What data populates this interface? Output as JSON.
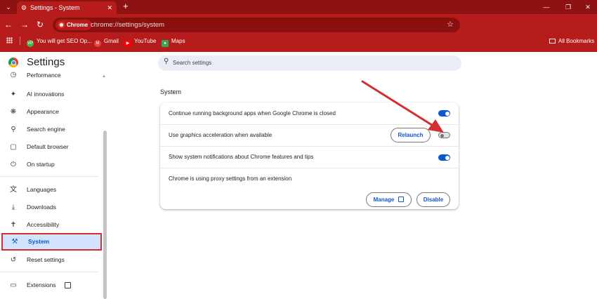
{
  "browser": {
    "tab_title": "Settings - System",
    "new_tab_glyph": "+",
    "chip_label": "Chrome",
    "url": "chrome://settings/system",
    "bookmarks": [
      {
        "label": "You will get SEO Op...",
        "icon": "vp-badge-icon",
        "color": "#4caf50"
      },
      {
        "label": "Gmail",
        "icon": "gmail-icon",
        "color": "#ea4335"
      },
      {
        "label": "YouTube",
        "icon": "youtube-icon",
        "color": "#ff0000"
      },
      {
        "label": "Maps",
        "icon": "maps-icon",
        "color": "#34a853"
      }
    ],
    "all_bookmarks": "All Bookmarks",
    "accent": "#b71c1c"
  },
  "header": {
    "title": "Settings",
    "search_placeholder": "Search settings"
  },
  "sidebar": {
    "items": [
      {
        "label": "Performance",
        "icon": "performance-icon"
      },
      {
        "label": "AI innovations",
        "icon": "sparkle-icon"
      },
      {
        "label": "Appearance",
        "icon": "palette-icon"
      },
      {
        "label": "Search engine",
        "icon": "search-icon"
      },
      {
        "label": "Default browser",
        "icon": "browser-window-icon"
      },
      {
        "label": "On startup",
        "icon": "power-icon"
      },
      {
        "label": "Languages",
        "icon": "translate-icon"
      },
      {
        "label": "Downloads",
        "icon": "download-icon"
      },
      {
        "label": "Accessibility",
        "icon": "accessibility-icon"
      },
      {
        "label": "System",
        "icon": "wrench-icon",
        "active": true
      },
      {
        "label": "Reset settings",
        "icon": "reset-icon"
      },
      {
        "label": "Extensions",
        "icon": "puzzle-icon"
      }
    ]
  },
  "main": {
    "section_title": "System",
    "rows": [
      {
        "label": "Continue running background apps when Google Chrome is closed",
        "toggle": true
      },
      {
        "label": "Use graphics acceleration when available",
        "toggle": false,
        "button": "Relaunch"
      },
      {
        "label": "Show system notifications about Chrome features and tips",
        "toggle": true
      },
      {
        "label": "Chrome is using proxy settings from an extension"
      }
    ],
    "proxy_buttons": {
      "manage": "Manage",
      "disable": "Disable"
    }
  },
  "colors": {
    "toggle_on": "#0b57d0",
    "active_highlight": "#d3e3fd",
    "annotation_red": "#d32f2f"
  }
}
